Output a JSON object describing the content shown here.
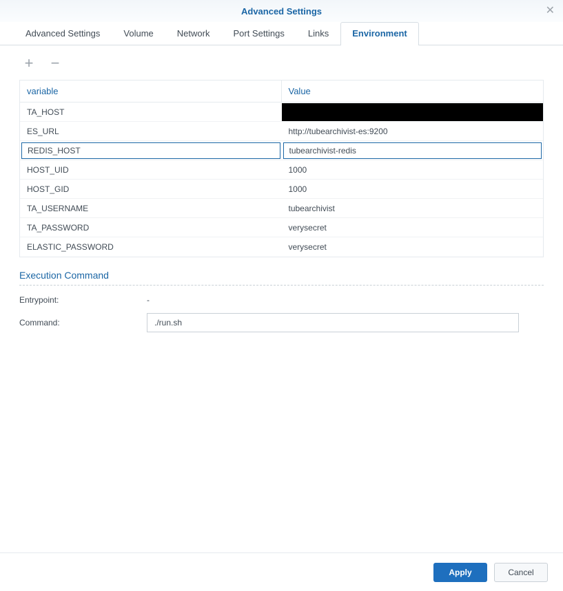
{
  "header": {
    "title": "Advanced Settings"
  },
  "tabs": [
    {
      "label": "Advanced Settings",
      "active": false
    },
    {
      "label": "Volume",
      "active": false
    },
    {
      "label": "Network",
      "active": false
    },
    {
      "label": "Port Settings",
      "active": false
    },
    {
      "label": "Links",
      "active": false
    },
    {
      "label": "Environment",
      "active": true
    }
  ],
  "env_table": {
    "headers": {
      "variable": "variable",
      "value": "Value"
    },
    "selected_index": 2,
    "rows": [
      {
        "variable": "TA_HOST",
        "value": "",
        "redacted": true
      },
      {
        "variable": "ES_URL",
        "value": "http://tubearchivist-es:9200"
      },
      {
        "variable": "REDIS_HOST",
        "value": "tubearchivist-redis"
      },
      {
        "variable": "HOST_UID",
        "value": "1000"
      },
      {
        "variable": "HOST_GID",
        "value": "1000"
      },
      {
        "variable": "TA_USERNAME",
        "value": "tubearchivist"
      },
      {
        "variable": "TA_PASSWORD",
        "value": "verysecret"
      },
      {
        "variable": "ELASTIC_PASSWORD",
        "value": "verysecret"
      }
    ]
  },
  "execution": {
    "title": "Execution Command",
    "entrypoint_label": "Entrypoint:",
    "entrypoint_value": "-",
    "command_label": "Command:",
    "command_value": "./run.sh"
  },
  "buttons": {
    "apply": "Apply",
    "cancel": "Cancel"
  }
}
